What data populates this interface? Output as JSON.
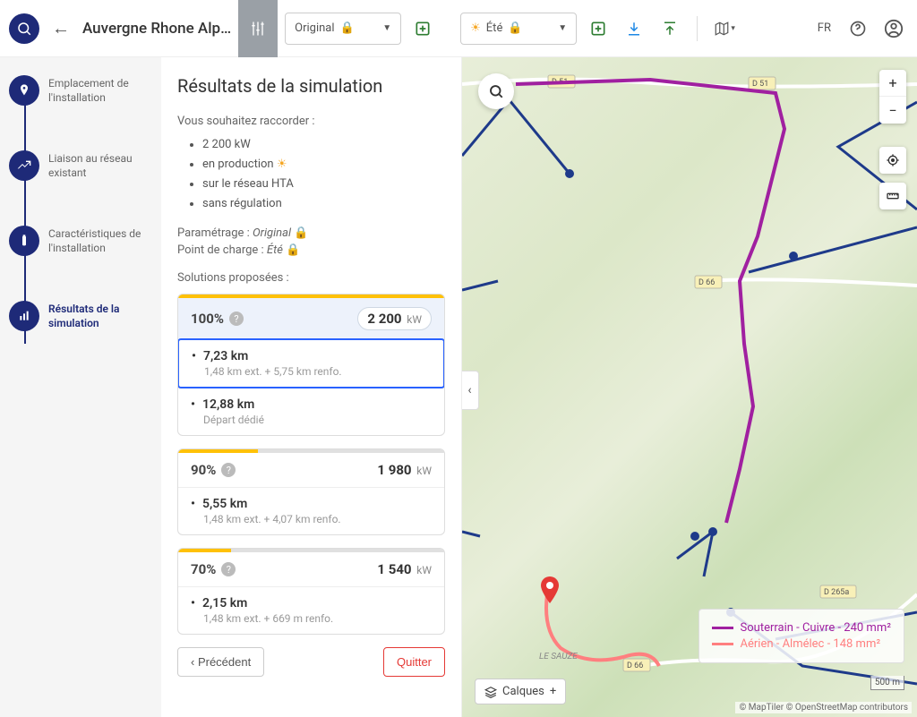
{
  "header": {
    "title": "Auvergne Rhone Alp…",
    "dropdown1": "Original",
    "dropdown2": "Été",
    "lang": "FR"
  },
  "steps": [
    {
      "label": "Emplacement de l'installation"
    },
    {
      "label": "Liaison au réseau existant"
    },
    {
      "label": "Caractéristiques de l'installation"
    },
    {
      "label": "Résultats de la simulation"
    }
  ],
  "panel": {
    "heading": "Résultats de la simulation",
    "intro": "Vous souhaitez raccorder :",
    "bullets": {
      "power": "2 200 kW",
      "mode": "en production",
      "network": "sur le réseau HTA",
      "regulation": "sans régulation"
    },
    "param_label": "Paramétrage :",
    "param_value": "Original",
    "charge_label": "Point de charge :",
    "charge_value": "Été",
    "solutions_label": "Solutions proposées :",
    "cards": [
      {
        "pct": "100%",
        "power": "2 200",
        "unit": "kW",
        "bar_yellow_pct": 100,
        "rows": [
          {
            "dist": "7,23 km",
            "detail": "1,48 km ext. + 5,75 km renfo.",
            "active": true
          },
          {
            "dist": "12,88 km",
            "detail": "Départ dédié"
          }
        ]
      },
      {
        "pct": "90%",
        "power": "1 980",
        "unit": "kW",
        "bar_yellow_pct": 30,
        "rows": [
          {
            "dist": "5,55 km",
            "detail": "1,48 km ext. + 4,07 km renfo."
          }
        ]
      },
      {
        "pct": "70%",
        "power": "1 540",
        "unit": "kW",
        "bar_yellow_pct": 20,
        "rows": [
          {
            "dist": "2,15 km",
            "detail": "1,48 km ext. + 669 m renfo."
          }
        ]
      }
    ],
    "prev_btn": "Précédent",
    "quit_btn": "Quitter"
  },
  "map": {
    "layers_btn": "Calques",
    "scale": "500 m",
    "attrib": "© MapTiler © OpenStreetMap contributors",
    "place": "LE SAUZE",
    "roads": [
      "D 51",
      "D 51",
      "D 66",
      "D 265a",
      "D 66"
    ],
    "legend": [
      {
        "label": "Souterrain - Cuivre - 240 mm²",
        "color": "#a020a0"
      },
      {
        "label": "Aérien - Almélec - 148 mm²",
        "color": "#ff7f7f"
      }
    ]
  }
}
